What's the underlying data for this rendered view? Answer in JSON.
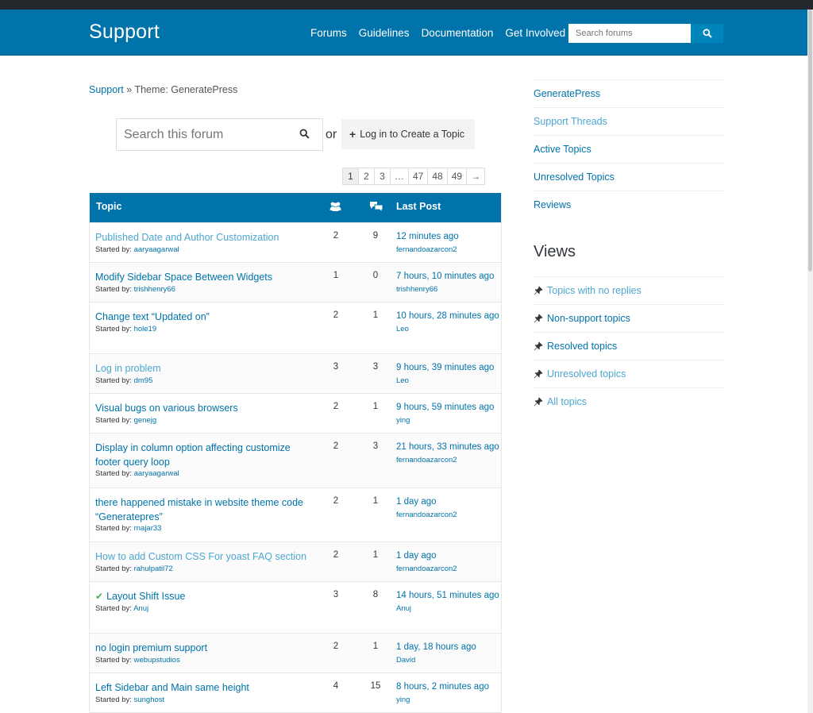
{
  "header": {
    "site_title": "Support",
    "nav": [
      "Forums",
      "Guidelines",
      "Documentation",
      "Get Involved"
    ],
    "search_placeholder": "Search forums"
  },
  "breadcrumb": {
    "root": "Support",
    "separator": " » ",
    "current": "Theme: GeneratePress"
  },
  "forum_search": {
    "placeholder": "Search this forum",
    "or": "or",
    "create_label": "Log in to Create a Topic"
  },
  "pagination": [
    "1",
    "2",
    "3",
    "…",
    "47",
    "48",
    "49",
    "→"
  ],
  "table": {
    "col_topic": "Topic",
    "col_last_post": "Last Post",
    "started_by_label": "Started by:",
    "rows": [
      {
        "title": "Published Date and Author Customization",
        "author": "aaryaagarwal",
        "voices": "2",
        "posts": "9",
        "freshness": "12 minutes ago",
        "last_author": "fernandoazarcon2",
        "visited": true,
        "resolved": false
      },
      {
        "title": "Modify Sidebar Space Between Widgets",
        "author": "trishhenry66",
        "voices": "1",
        "posts": "0",
        "freshness": "7 hours, 10 minutes ago",
        "last_author": "trishhenry66",
        "visited": false,
        "resolved": false
      },
      {
        "title": "Change text “Updated on”",
        "author": "hole19",
        "voices": "2",
        "posts": "1",
        "freshness": "10 hours, 28 minutes ago",
        "last_author": "Leo",
        "visited": false,
        "resolved": false
      },
      {
        "title": "Log in problem",
        "author": "dm95",
        "voices": "3",
        "posts": "3",
        "freshness": "9 hours, 39 minutes ago",
        "last_author": "Leo",
        "visited": true,
        "resolved": false
      },
      {
        "title": "Visual bugs on various browsers",
        "author": "genejg",
        "voices": "2",
        "posts": "1",
        "freshness": "9 hours, 59 minutes ago",
        "last_author": "ying",
        "visited": false,
        "resolved": false
      },
      {
        "title": "Display in column option affecting customize footer query loop",
        "author": "aaryaagarwal",
        "voices": "2",
        "posts": "3",
        "freshness": "21 hours, 33 minutes ago",
        "last_author": "fernandoazarcon2",
        "visited": false,
        "resolved": false
      },
      {
        "title": "there happened mistake in website theme code “Generatepres”",
        "author": "rnajar33",
        "voices": "2",
        "posts": "1",
        "freshness": "1 day ago",
        "last_author": "fernandoazarcon2",
        "visited": false,
        "resolved": false
      },
      {
        "title": "How to add Custom CSS For yoast FAQ section",
        "author": "rahulpatil72",
        "voices": "2",
        "posts": "1",
        "freshness": "1 day ago",
        "last_author": "fernandoazarcon2",
        "visited": true,
        "resolved": false
      },
      {
        "title": "Layout Shift Issue",
        "author": "Anuj",
        "voices": "3",
        "posts": "8",
        "freshness": "14 hours, 51 minutes ago",
        "last_author": "Anuj",
        "visited": false,
        "resolved": true
      },
      {
        "title": "no login premium support",
        "author": "webupstudios",
        "voices": "2",
        "posts": "1",
        "freshness": "1 day, 18 hours ago",
        "last_author": "David",
        "visited": false,
        "resolved": false
      },
      {
        "title": "Left Sidebar and Main same height",
        "author": "sunghost",
        "voices": "4",
        "posts": "15",
        "freshness": "8 hours, 2 minutes ago",
        "last_author": "ying",
        "visited": false,
        "resolved": false
      }
    ]
  },
  "sidebar": {
    "links": [
      {
        "label": "GeneratePress",
        "visited": false
      },
      {
        "label": "Support Threads",
        "visited": true
      },
      {
        "label": "Active Topics",
        "visited": false
      },
      {
        "label": "Unresolved Topics",
        "visited": false
      },
      {
        "label": "Reviews",
        "visited": false
      }
    ],
    "views_title": "Views",
    "views": [
      {
        "label": "Topics with no replies",
        "visited": true
      },
      {
        "label": "Non-support topics",
        "visited": false
      },
      {
        "label": "Resolved topics",
        "visited": false
      },
      {
        "label": "Unresolved topics",
        "visited": true
      },
      {
        "label": "All topics",
        "visited": true
      }
    ]
  },
  "colors": {
    "brand": "#0073aa",
    "topbar": "#23282d",
    "link_visited": "#4ca6cf",
    "resolved_check": "#46b450"
  }
}
